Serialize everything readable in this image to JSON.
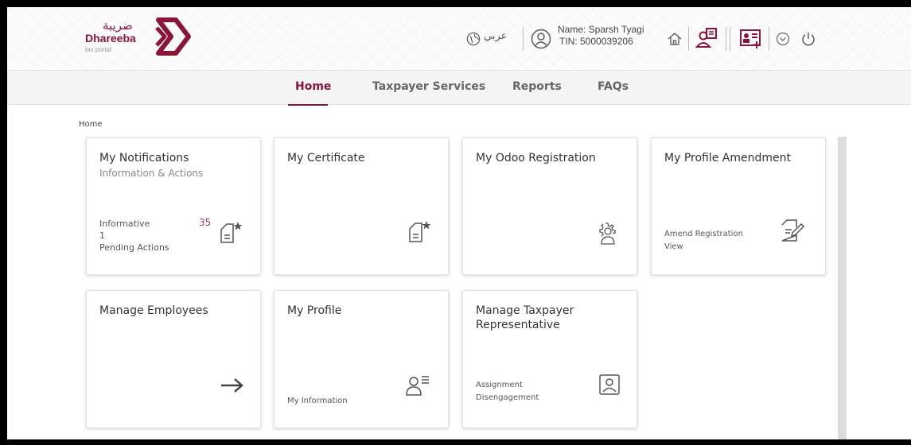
{
  "header": {
    "logo": {
      "arabic": "ضريبة",
      "english": "Dhareeba",
      "sub": "tax portal"
    },
    "language_label": "عربي",
    "user_name": "Name: Sparsh Tyagi",
    "user_tin": "TIN: 5000039206",
    "brand_color": "#8a1538"
  },
  "nav": {
    "items": [
      {
        "label": "Home",
        "active": true
      },
      {
        "label": "Taxpayer Services",
        "active": false
      },
      {
        "label": "Reports",
        "active": false
      },
      {
        "label": "FAQs",
        "active": false
      }
    ]
  },
  "breadcrumb": "Home",
  "cards": {
    "notifications": {
      "title": "My Notifications",
      "subtitle": "Information & Actions",
      "informative_label": "Informative",
      "informative_count": "35",
      "pending_count": "1",
      "pending_label": "Pending Actions",
      "icon": "certificate-star-icon"
    },
    "certificate": {
      "title": "My Certificate",
      "icon": "certificate-star-icon"
    },
    "odoo": {
      "title": "My Odoo Registration",
      "icon": "user-gear-icon"
    },
    "amendment": {
      "title": "My Profile Amendment",
      "line1": "Amend Registration",
      "line2": "View",
      "icon": "document-edit-icon"
    },
    "employees": {
      "title": "Manage Employees",
      "icon": "arrow-right-icon"
    },
    "profile": {
      "title": "My Profile",
      "line1": "My Information",
      "icon": "user-list-icon"
    },
    "representative": {
      "title_line1": "Manage Taxpayer",
      "title_line2": "Representative",
      "line1": "Assignment",
      "line2": "Disengagement",
      "icon": "user-frame-icon"
    }
  }
}
